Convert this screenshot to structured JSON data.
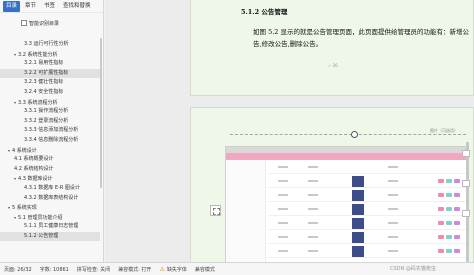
{
  "nav": {
    "tabs": [
      "目录",
      "章节",
      "书签",
      "查找和替换"
    ],
    "active_tab": 0,
    "smart_toc_label": "智能识别目录",
    "items": [
      {
        "label": "3.3 运行可行性分析",
        "level": 2,
        "caret": false,
        "highlighted": false
      },
      {
        "label": "3.2 系统性能分析",
        "level": 1,
        "caret": true,
        "highlighted": false
      },
      {
        "label": "3.2.1 易用性指标",
        "level": 2,
        "caret": false,
        "highlighted": false
      },
      {
        "label": "3.2.2 可扩展性指标",
        "level": 2,
        "caret": false,
        "highlighted": true
      },
      {
        "label": "3.2.3 健壮性指标",
        "level": 2,
        "caret": false,
        "highlighted": false
      },
      {
        "label": "3.2.4 安全性指标",
        "level": 2,
        "caret": false,
        "highlighted": false
      },
      {
        "label": "3.3 系统流程分析",
        "level": 1,
        "caret": true,
        "highlighted": false
      },
      {
        "label": "3.3.1 操作流程分析",
        "level": 2,
        "caret": false,
        "highlighted": false
      },
      {
        "label": "3.3.2 登录流程分析",
        "level": 2,
        "caret": false,
        "highlighted": false
      },
      {
        "label": "3.3.3 信息添加流程分析",
        "level": 2,
        "caret": false,
        "highlighted": false
      },
      {
        "label": "3.3.4 信息删除流程分析",
        "level": 2,
        "caret": false,
        "highlighted": false
      },
      {
        "label": "4 系统设计",
        "level": 0,
        "caret": true,
        "highlighted": false
      },
      {
        "label": "4.1 系统概要设计",
        "level": 1,
        "caret": false,
        "highlighted": false
      },
      {
        "label": "4.2 系统结构设计",
        "level": 1,
        "caret": false,
        "highlighted": false
      },
      {
        "label": "4.3 数据库设计",
        "level": 1,
        "caret": true,
        "highlighted": false
      },
      {
        "label": "4.3.1 数据库 E-R 图设计",
        "level": 2,
        "caret": false,
        "highlighted": false
      },
      {
        "label": "4.3.2 数据库表结构设计",
        "level": 2,
        "caret": false,
        "highlighted": false
      },
      {
        "label": "5 系统实现",
        "level": 0,
        "caret": true,
        "highlighted": false
      },
      {
        "label": "5.1 管理员功能介绍",
        "level": 1,
        "caret": true,
        "highlighted": false
      },
      {
        "label": "5.1.1 员工健康日志管理",
        "level": 2,
        "caret": false,
        "highlighted": false
      },
      {
        "label": "5.1.2 公告管理",
        "level": 2,
        "caret": false,
        "highlighted": true
      }
    ]
  },
  "document": {
    "heading": "5.1.2 公告管理",
    "paragraph_line1": "如图 5.2 显示的就是公告管理页面，此页面提供给管理员的功能有：新增公",
    "paragraph_line2": "告,修改公告,删除公告。",
    "footnote": "✓ 26",
    "image_tag": "图片（可选项）"
  },
  "status_bar": {
    "page": "页面: 26/32",
    "words": "字数: 10861",
    "spellcheck": "拼写检查: 关闭",
    "compat": "兼容模式: 打开",
    "missing_font": "缺失字体",
    "compat_mode": "兼容模式"
  },
  "watermark": "CSDN @码农猫爬虫"
}
